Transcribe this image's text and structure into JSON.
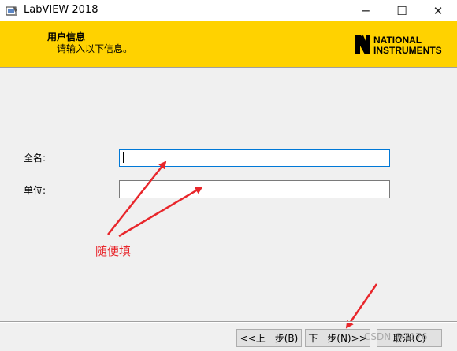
{
  "window": {
    "title": "LabVIEW 2018",
    "min_glyph": "─",
    "max_glyph": "☐",
    "close_glyph": "✕"
  },
  "banner": {
    "title": "用户信息",
    "subtitle": "请输入以下信息。",
    "logo_text": "NATIONAL INSTRUMENTS",
    "color": "#ffd200"
  },
  "form": {
    "fullname_label": "全名:",
    "fullname_value": "",
    "company_label": "单位:",
    "company_value": ""
  },
  "annotation": {
    "text": "随便填",
    "color": "#e8262b"
  },
  "buttons": {
    "back": "<<上一步(B)",
    "next": "下一步(N)>>",
    "cancel": "取消(C)"
  },
  "watermark": "CSDN @7176"
}
